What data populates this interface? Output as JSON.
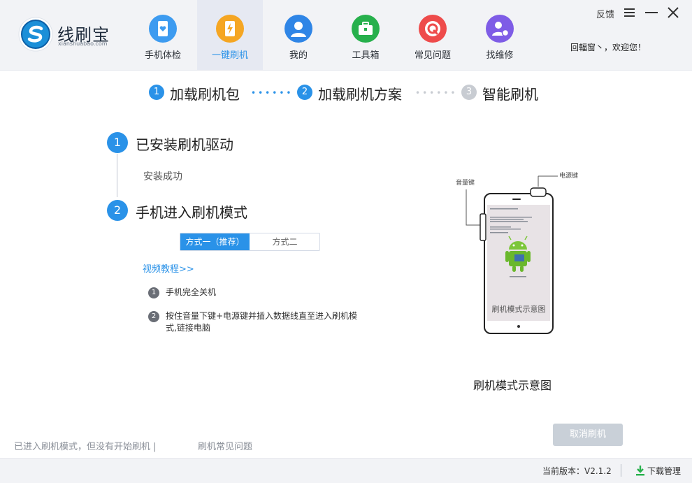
{
  "app": {
    "logo_name": "线刷宝",
    "logo_sub": "xianshuabao.com"
  },
  "nav": [
    {
      "label": "手机体检",
      "icon": "phone-heart-icon",
      "color": "#3d9bf0"
    },
    {
      "label": "一键刷机",
      "icon": "lightning-phone-icon",
      "color": "#f5a623",
      "active": true
    },
    {
      "label": "我的",
      "icon": "user-icon",
      "color": "#2f85e6"
    },
    {
      "label": "工具箱",
      "icon": "toolbox-icon",
      "color": "#27b04c"
    },
    {
      "label": "常见问题",
      "icon": "question-icon",
      "color": "#ee4b4b"
    },
    {
      "label": "找维修",
      "icon": "repair-icon",
      "color": "#7e5ce6"
    }
  ],
  "header": {
    "feedback": "反馈",
    "welcome": "回輻窗丶，欢迎您！"
  },
  "steps": [
    {
      "num": "1",
      "label": "加载刷机包",
      "state": "done"
    },
    {
      "num": "2",
      "label": "加载刷机方案",
      "state": "current"
    },
    {
      "num": "3",
      "label": "智能刷机",
      "state": "pending"
    }
  ],
  "section1": {
    "num": "1",
    "title": "已安装刷机驱动",
    "status": "安装成功"
  },
  "section2": {
    "num": "2",
    "title": "手机进入刷机模式",
    "tabs": [
      "方式一（推荐）",
      "方式二"
    ],
    "video_link": "视频教程>>",
    "instructions": [
      {
        "num": "1",
        "text": "手机完全关机"
      },
      {
        "num": "2",
        "text_line1": "按住音量下键+电源键并插入数据线直至进入刷机模",
        "text_line2": "式,链接电脑"
      }
    ]
  },
  "illustration": {
    "volume_key_label": "音量键",
    "power_key_label": "电源键",
    "screen_text": "刷机模式示意图",
    "caption": "刷机模式示意图"
  },
  "actions": {
    "cancel": "取消刷机"
  },
  "status_bar": {
    "left": "已进入刷机模式，但没有开始刷机 |",
    "faq": "刷机常见问题"
  },
  "footer": {
    "version": "当前版本：V2.1.2",
    "download": "下载管理"
  },
  "colors": {
    "accent": "#2a92e8",
    "pending": "#c8ccd2",
    "cancel_bg": "#c9d0d8"
  }
}
